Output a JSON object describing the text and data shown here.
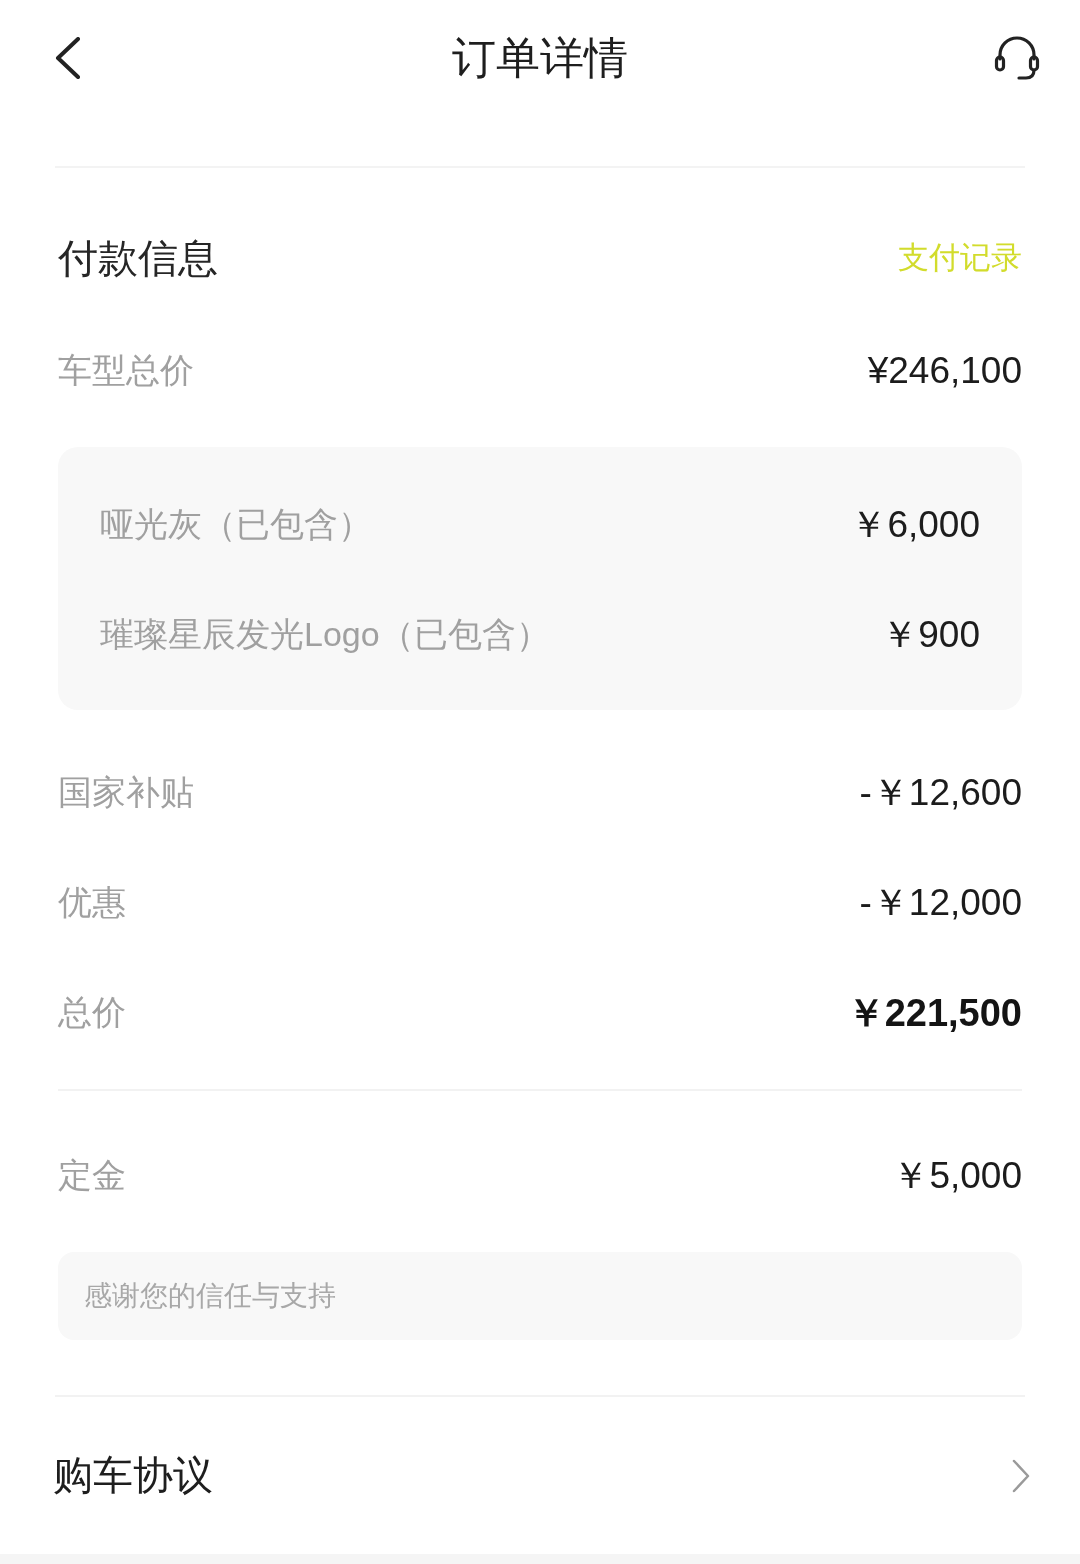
{
  "header": {
    "title": "订单详情"
  },
  "payment": {
    "title": "付款信息",
    "link": "支付记录",
    "rows": [
      {
        "kind": "line",
        "label": "车型总价",
        "value": "¥246,100"
      },
      {
        "kind": "group",
        "items": [
          {
            "label": "哑光灰（已包含）",
            "value": "￥6,000"
          },
          {
            "label": "璀璨星辰发光Logo（已包含）",
            "value": "￥900"
          }
        ]
      },
      {
        "kind": "line",
        "label": "国家补贴",
        "value": "-￥12,600"
      },
      {
        "kind": "line",
        "label": "优惠",
        "value": "-￥12,000"
      },
      {
        "kind": "total",
        "label": "总价",
        "value": "￥221,500"
      }
    ],
    "deposit": {
      "label": "定金",
      "value": "￥5,000"
    },
    "note": "感谢您的信任与支持"
  },
  "agreement": {
    "label": "购车协议"
  }
}
